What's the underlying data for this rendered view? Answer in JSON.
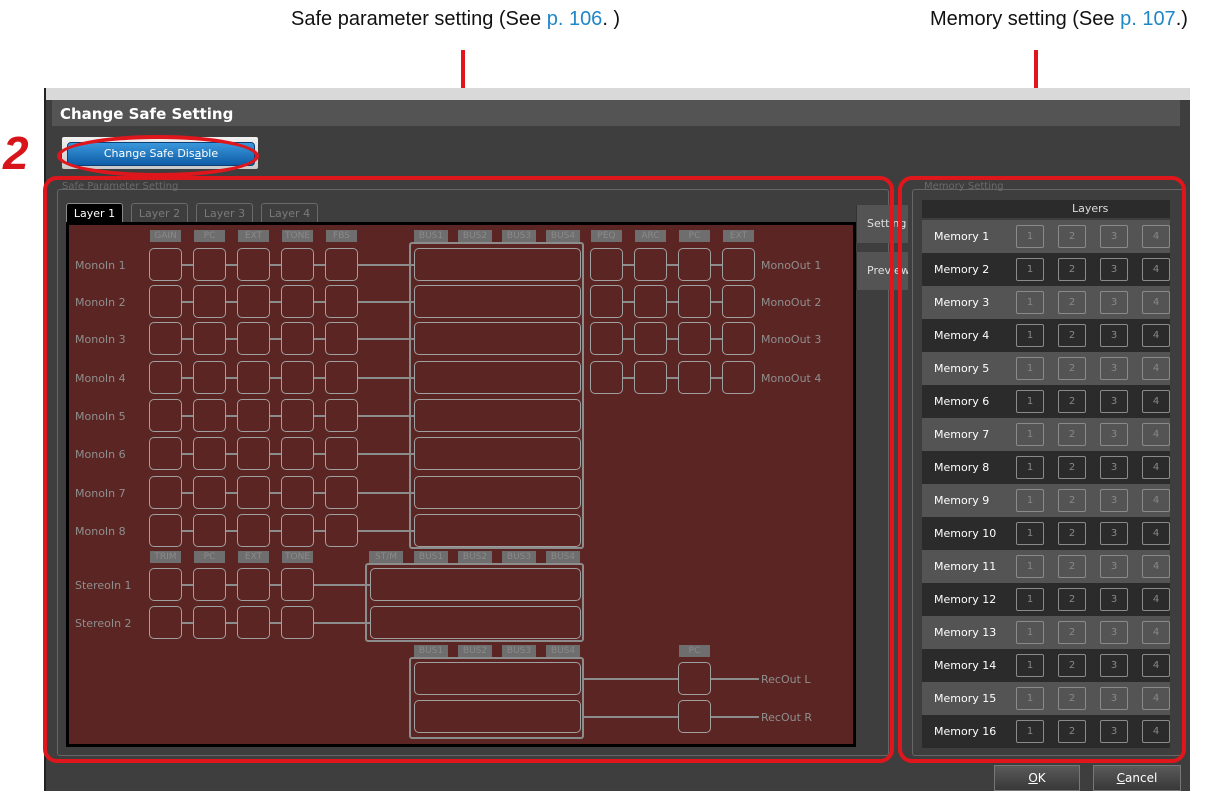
{
  "callouts": {
    "safe": {
      "text": "Safe parameter setting (See ",
      "link": "p. 106",
      "tail": ". )"
    },
    "memory": {
      "text": "Memory setting (See ",
      "link": "p. 107",
      "tail": ".)"
    }
  },
  "step_number": "2",
  "window": {
    "title": "Change Safe Setting",
    "change_safe_button": {
      "prefix": "Change Safe  Dis",
      "underlined": "a",
      "suffix": "ble"
    },
    "safe_panel_title": "Safe Parameter Setting",
    "memory_panel_title": "Memory Setting"
  },
  "tabs": [
    "Layer 1",
    "Layer 2",
    "Layer 3",
    "Layer 4"
  ],
  "side_tabs": [
    "Setting",
    "Preview"
  ],
  "mono_headers": [
    "GAIN",
    "PC",
    "EXT",
    "TONE",
    "FBS"
  ],
  "bus_headers": [
    "BUS1",
    "BUS2",
    "BUS3",
    "BUS4"
  ],
  "out_headers": [
    "PEQ",
    "ARC",
    "PC",
    "EXT"
  ],
  "stereo_headers": [
    "TRIM",
    "PC",
    "EXT",
    "TONE"
  ],
  "stm_header": "ST/M",
  "rec_pc_header": "PC",
  "mono_inputs": [
    "MonoIn 1",
    "MonoIn 2",
    "MonoIn 3",
    "MonoIn 4",
    "MonoIn 5",
    "MonoIn 6",
    "MonoIn 7",
    "MonoIn 8"
  ],
  "mono_outputs": [
    "MonoOut 1",
    "MonoOut 2",
    "MonoOut 3",
    "MonoOut 4"
  ],
  "stereo_inputs": [
    "StereoIn 1",
    "StereoIn 2"
  ],
  "rec_outputs": [
    "RecOut L",
    "RecOut R"
  ],
  "memory": {
    "header": "Layers",
    "layer_buttons": [
      "1",
      "2",
      "3",
      "4"
    ],
    "rows": [
      "Memory 1",
      "Memory 2",
      "Memory 3",
      "Memory 4",
      "Memory 5",
      "Memory 6",
      "Memory 7",
      "Memory 8",
      "Memory 9",
      "Memory 10",
      "Memory 11",
      "Memory 12",
      "Memory 13",
      "Memory 14",
      "Memory 15",
      "Memory 16"
    ]
  },
  "buttons": {
    "ok": {
      "underlined": "O",
      "rest": "K"
    },
    "cancel": {
      "underlined": "C",
      "rest": "ancel"
    }
  },
  "colors": {
    "accent_red": "#e0161d",
    "canvas_bg": "#5a2522",
    "button_blue": "#1e7bc8",
    "link_blue": "#1f86c8"
  }
}
